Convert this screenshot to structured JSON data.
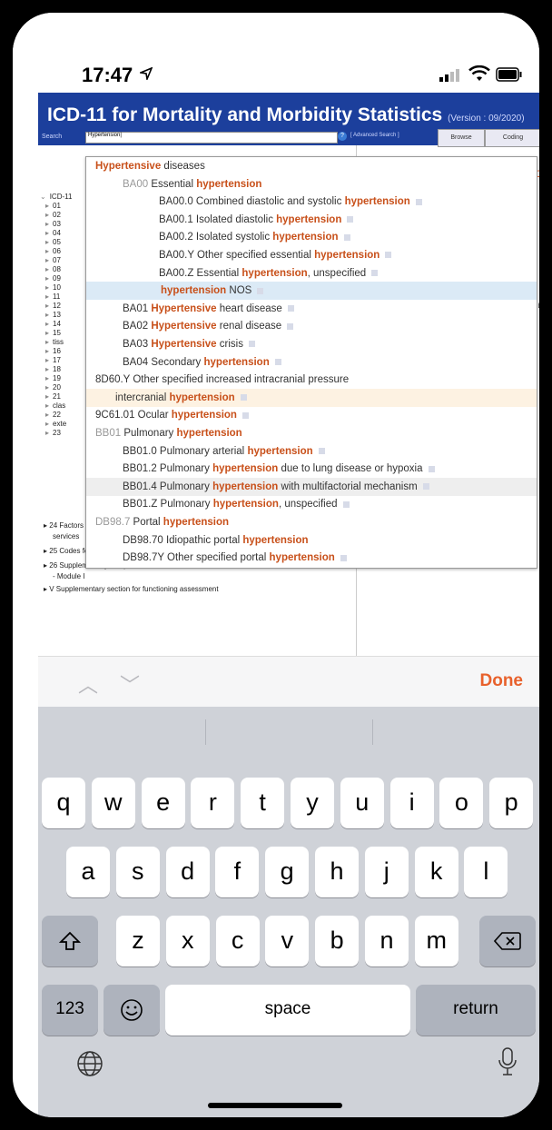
{
  "status_bar": {
    "time": "17:47"
  },
  "web": {
    "title": "ICD-11 for Mortality and Morbidity Statistics",
    "version": "(Version : 09/2020)",
    "search_label": "Search",
    "search_value": "Hypertension|",
    "advanced_search": "[ Advanced Search ]",
    "tabs": [
      "Browse",
      "Coding"
    ],
    "tree_top": [
      "ICD-11",
      "01",
      "02",
      "03",
      "04",
      "05",
      "06",
      "07",
      "08",
      "09",
      "10",
      "11",
      "12",
      "13",
      "14",
      "15",
      "tiss",
      "16",
      "17",
      "18",
      "19",
      "20",
      "21",
      "clas",
      "22",
      "exte",
      "23"
    ],
    "tree_bottom": [
      "24 Factors influencing health status or contact with health",
      "services",
      "25 Codes for special purposes",
      "26 Supplementary Chapter Traditional Medicine Conditions",
      "- Module I",
      "V Supplementary section for functioning assessment"
    ],
    "right_frags": [
      "d Mort",
      "ion",
      "CD-11 M",
      "place, b"
    ],
    "dropdown": [
      {
        "pre": "",
        "kw": "Hypertensive",
        "post": " diseases",
        "sq": false
      },
      {
        "code": "BA00",
        "pre": " Essential ",
        "kw": "hypertension",
        "post": "",
        "sq": false
      },
      {
        "pre": "BA00.0 Combined diastolic and systolic ",
        "kw": "hypertension",
        "post": "",
        "sq": true
      },
      {
        "pre": "BA00.1 Isolated diastolic ",
        "kw": "hypertension",
        "post": "",
        "sq": true
      },
      {
        "pre": "BA00.2 Isolated systolic ",
        "kw": "hypertension",
        "post": "",
        "sq": true
      },
      {
        "pre": "BA00.Y Other specified essential ",
        "kw": "hypertension",
        "post": "",
        "sq": true
      },
      {
        "pre": "BA00.Z Essential ",
        "kw": "hypertension",
        "post": ", unspecified",
        "sq": true
      },
      {
        "pre": "",
        "kw": "hypertension",
        "post": " NOS",
        "sq": true
      },
      {
        "pre": "BA01 ",
        "kw": "Hypertensive",
        "post": " heart disease",
        "sq": true
      },
      {
        "pre": "BA02 ",
        "kw": "Hypertensive",
        "post": " renal disease",
        "sq": true
      },
      {
        "pre": "BA03 ",
        "kw": "Hypertensive",
        "post": " crisis",
        "sq": true
      },
      {
        "pre": "BA04 Secondary ",
        "kw": "hypertension",
        "post": "",
        "sq": true
      },
      {
        "pre": "8D60.Y Other specified increased intracranial pressure",
        "kw": "",
        "post": "",
        "sq": false
      },
      {
        "pre": "intercranial ",
        "kw": "hypertension",
        "post": "",
        "sq": true
      },
      {
        "pre": "9C61.01 Ocular ",
        "kw": "hypertension",
        "post": "",
        "sq": true
      },
      {
        "code": "BB01",
        "pre": " Pulmonary ",
        "kw": "hypertension",
        "post": "",
        "sq": false
      },
      {
        "pre": "BB01.0 Pulmonary arterial ",
        "kw": "hypertension",
        "post": "",
        "sq": true
      },
      {
        "pre": "BB01.2 Pulmonary ",
        "kw": "hypertension",
        "post": " due to lung disease or hypoxia",
        "sq": true
      },
      {
        "pre": "BB01.4 Pulmonary ",
        "kw": "hypertension",
        "post": " with multifactorial mechanism",
        "sq": true
      },
      {
        "pre": "BB01.Z Pulmonary ",
        "kw": "hypertension",
        "post": ", unspecified",
        "sq": true
      },
      {
        "code": "DB98.7",
        "pre": " Portal ",
        "kw": "hypertension",
        "post": "",
        "sq": false
      },
      {
        "pre": "DB98.70 Idiopathic portal ",
        "kw": "hypertension",
        "post": "",
        "sq": false
      },
      {
        "pre": "DB98.7Y Other specified portal ",
        "kw": "hypertension",
        "post": "",
        "sq": true
      }
    ]
  },
  "accessory": {
    "prev_icon": "chevron-up-icon",
    "next_icon": "chevron-down-icon",
    "done": "Done"
  },
  "keyboard": {
    "row1": [
      "q",
      "w",
      "e",
      "r",
      "t",
      "y",
      "u",
      "i",
      "o",
      "p"
    ],
    "row2": [
      "a",
      "s",
      "d",
      "f",
      "g",
      "h",
      "j",
      "k",
      "l"
    ],
    "row3": [
      "z",
      "x",
      "c",
      "v",
      "b",
      "n",
      "m"
    ],
    "numbers": "123",
    "space": "space",
    "return": "return"
  },
  "colors": {
    "header": "#1c3f9c",
    "keyword": "#c8501a",
    "done": "#e8612c"
  }
}
